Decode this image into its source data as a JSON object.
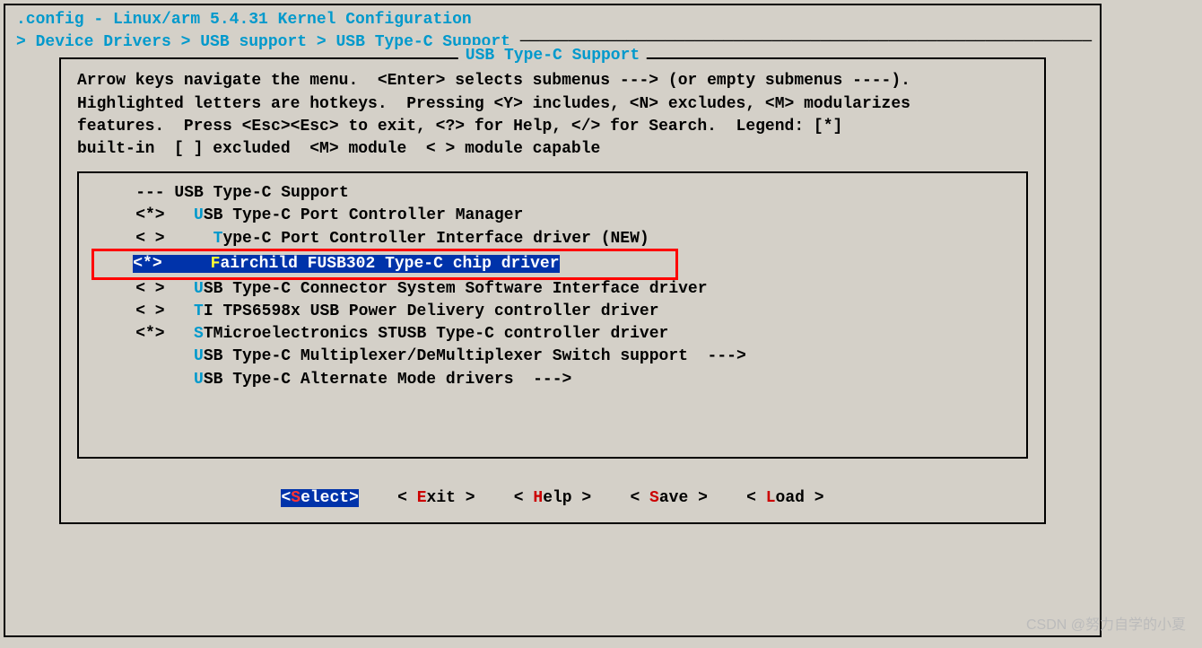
{
  "title": ".config - Linux/arm 5.4.31 Kernel Configuration",
  "breadcrumb": {
    "arrow1": "> ",
    "p1": "Device Drivers",
    "sep": " > ",
    "p2": "USB support",
    "p3": "USB Type-C Support"
  },
  "panel_title": "USB Type-C Support",
  "help_text": "Arrow keys navigate the menu.  <Enter> selects submenus ---> (or empty submenus ----).\nHighlighted letters are hotkeys.  Pressing <Y> includes, <N> excludes, <M> modularizes\nfeatures.  Press <Esc><Esc> to exit, <?> for Help, </> for Search.  Legend: [*]\nbuilt-in  [ ] excluded  <M> module  < > module capable",
  "menu": {
    "items": [
      {
        "prefix": "    --- ",
        "hotkey": "",
        "rest": "USB Type-C Support"
      },
      {
        "prefix": "    <*>   ",
        "hotkey": "U",
        "rest": "SB Type-C Port Controller Manager"
      },
      {
        "prefix": "    < >     ",
        "hotkey": "T",
        "rest": "ype-C Port Controller Interface driver (NEW)"
      },
      {
        "prefix": "<*>     ",
        "hotkey": "F",
        "rest": "airchild FUSB302 Type-C chip driver",
        "selected": true,
        "boxed": true
      },
      {
        "prefix": "    < >   ",
        "hotkey": "U",
        "rest": "SB Type-C Connector System Software Interface driver"
      },
      {
        "prefix": "    < >   ",
        "hotkey": "T",
        "rest": "I TPS6598x USB Power Delivery controller driver"
      },
      {
        "prefix": "    <*>   ",
        "hotkey": "S",
        "rest": "TMicroelectronics STUSB Type-C controller driver"
      },
      {
        "prefix": "          ",
        "hotkey": "U",
        "rest": "SB Type-C Multiplexer/DeMultiplexer Switch support  --->"
      },
      {
        "prefix": "          ",
        "hotkey": "U",
        "rest": "SB Type-C Alternate Mode drivers  --->"
      }
    ]
  },
  "buttons": {
    "select": {
      "open": "<",
      "hot": "S",
      "rest": "elect",
      "close": ">"
    },
    "exit": {
      "open": "< ",
      "hot": "E",
      "rest": "xit",
      "close": " >"
    },
    "help": {
      "open": "< ",
      "hot": "H",
      "rest": "elp",
      "close": " >"
    },
    "save": {
      "open": "< ",
      "hot": "S",
      "rest": "ave",
      "close": " >"
    },
    "load": {
      "open": "< ",
      "hot": "L",
      "rest": "oad",
      "close": " >"
    }
  },
  "watermark": "CSDN @努力自学的小夏"
}
